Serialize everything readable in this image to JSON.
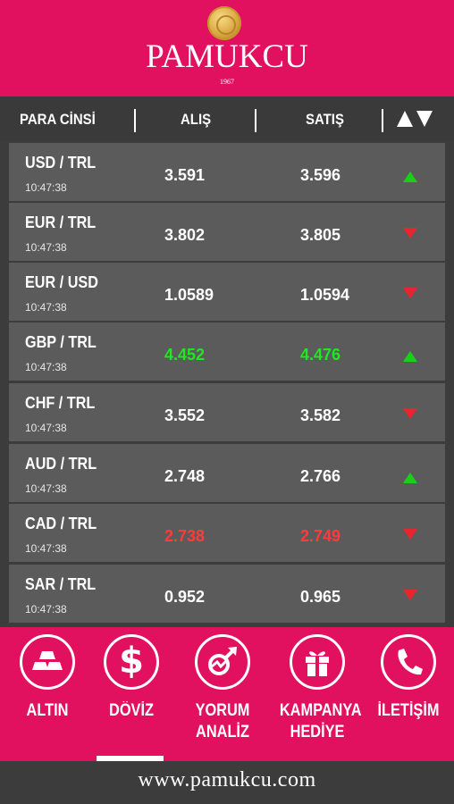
{
  "header": {
    "brand": "PAMUKCU",
    "year": "1967"
  },
  "columns": {
    "currency": "PARA CİNSİ",
    "buy": "ALIŞ",
    "sell": "SATIŞ"
  },
  "rates": [
    {
      "pair": "USD / TRL",
      "time": "10:47:38",
      "buy": "3.591",
      "sell": "3.596",
      "trend": "up",
      "value_color": "#ffffff"
    },
    {
      "pair": "EUR / TRL",
      "time": "10:47:38",
      "buy": "3.802",
      "sell": "3.805",
      "trend": "down",
      "value_color": "#ffffff"
    },
    {
      "pair": "EUR / USD",
      "time": "10:47:38",
      "buy": "1.0589",
      "sell": "1.0594",
      "trend": "down",
      "value_color": "#ffffff"
    },
    {
      "pair": "GBP / TRL",
      "time": "10:47:38",
      "buy": "4.452",
      "sell": "4.476",
      "trend": "up",
      "value_color": "#1ee81e"
    },
    {
      "pair": "CHF / TRL",
      "time": "10:47:38",
      "buy": "3.552",
      "sell": "3.582",
      "trend": "down",
      "value_color": "#ffffff"
    },
    {
      "pair": "AUD / TRL",
      "time": "10:47:38",
      "buy": "2.748",
      "sell": "2.766",
      "trend": "up",
      "value_color": "#ffffff"
    },
    {
      "pair": "CAD / TRL",
      "time": "10:47:38",
      "buy": "2.738",
      "sell": "2.749",
      "trend": "down",
      "value_color": "#ff3b3b"
    },
    {
      "pair": "SAR / TRL",
      "time": "10:47:38",
      "buy": "0.952",
      "sell": "0.965",
      "trend": "down",
      "value_color": "#ffffff"
    }
  ],
  "tabs": [
    {
      "label": "ALTIN",
      "icon": "gold-bars-icon"
    },
    {
      "label": "DÖVİZ",
      "icon": "dollar-icon",
      "active": true
    },
    {
      "label": "YORUM\nANALİZ",
      "icon": "analysis-icon"
    },
    {
      "label": "KAMPANYA\nHEDİYE",
      "icon": "gift-icon"
    },
    {
      "label": "İLETİŞİM",
      "icon": "phone-icon"
    }
  ],
  "footer": {
    "url": "www.pamukcu.com"
  },
  "colors": {
    "brand": "#e2115f",
    "row_bg": "#5b5b5b",
    "up": "#18d018",
    "down": "#e8252e"
  }
}
